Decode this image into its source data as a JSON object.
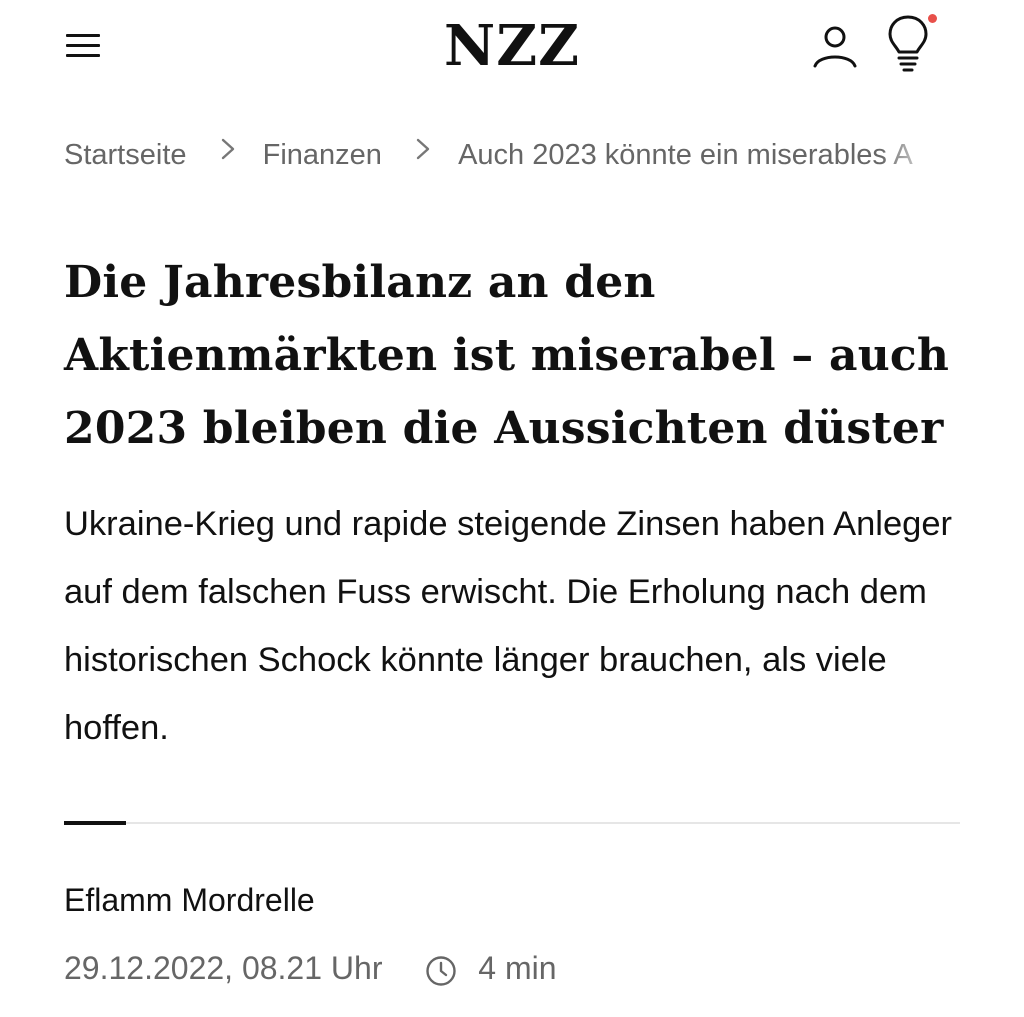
{
  "header": {
    "logo": "NZZ",
    "menu_icon": "hamburger-menu-icon",
    "user_icon": "user-icon",
    "bulb_icon": "lightbulb-icon",
    "notification_dot_color": "#e8504a"
  },
  "breadcrumb": {
    "items": [
      "Startseite",
      "Finanzen",
      "Auch 2023 könnte ein miserables A"
    ],
    "separator_icon": "chevron-right-icon"
  },
  "article": {
    "headline": "Die Jahresbilanz an den Aktienmärkten ist miserabel – auch 2023 bleiben die Aussichten düster",
    "lead": "Ukraine-Krieg und rapide steigende Zinsen haben Anleger auf dem falschen Fuss erwischt. Die Erholung nach dem historischen Schock könnte länger brauchen, als viele hoffen.",
    "author": "Eflamm Mordrelle",
    "date": "29.12.2022, 08.21 Uhr",
    "read_time": "4 min",
    "clock_icon": "clock-icon"
  }
}
